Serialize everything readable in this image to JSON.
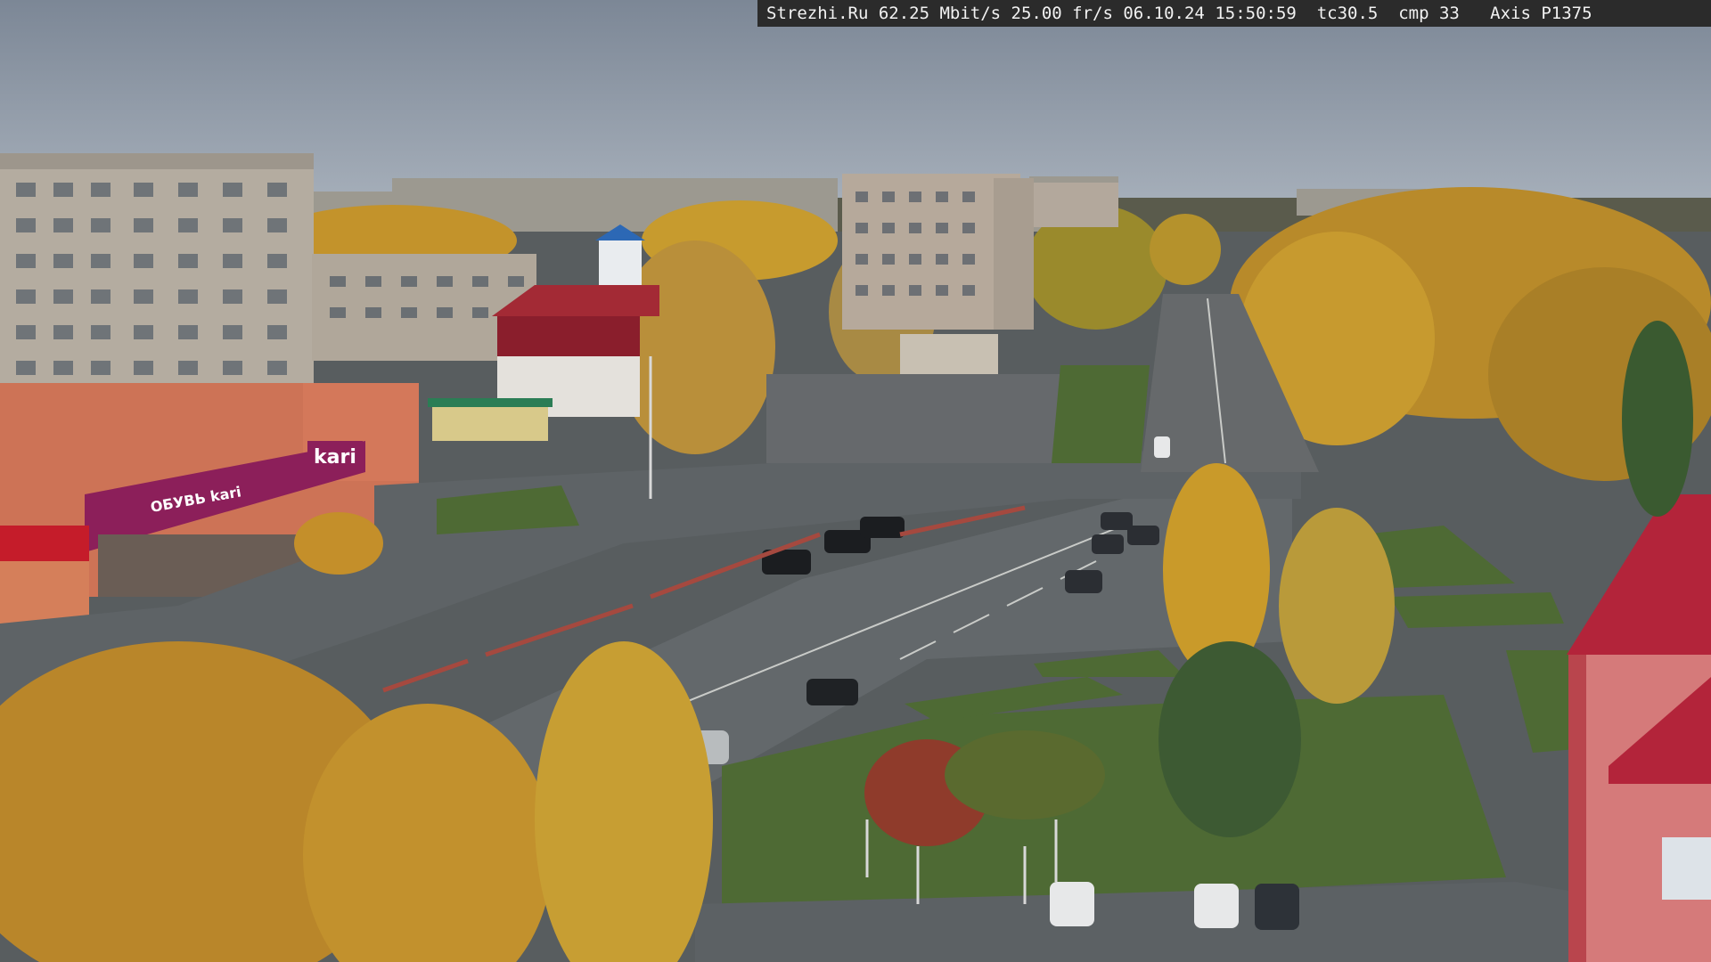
{
  "overlay": {
    "osd_text": "Strezhi.Ru 62.25 Mbit/s 25.00 fr/s 06.10.24 15:50:59  tc30.5  cmp 33   Axis P1375"
  },
  "signs": {
    "store_logo": "kari",
    "store_banner": "ОБУВЬ kari"
  },
  "colors": {
    "sky": "#8a97a8",
    "foliage_gold": "#c99a2a",
    "asphalt": "#5f6467",
    "grass": "#4d6b33",
    "store_facade": "#d0775a",
    "store_banner": "#8c1f5a",
    "roof_red": "#b3243a"
  }
}
